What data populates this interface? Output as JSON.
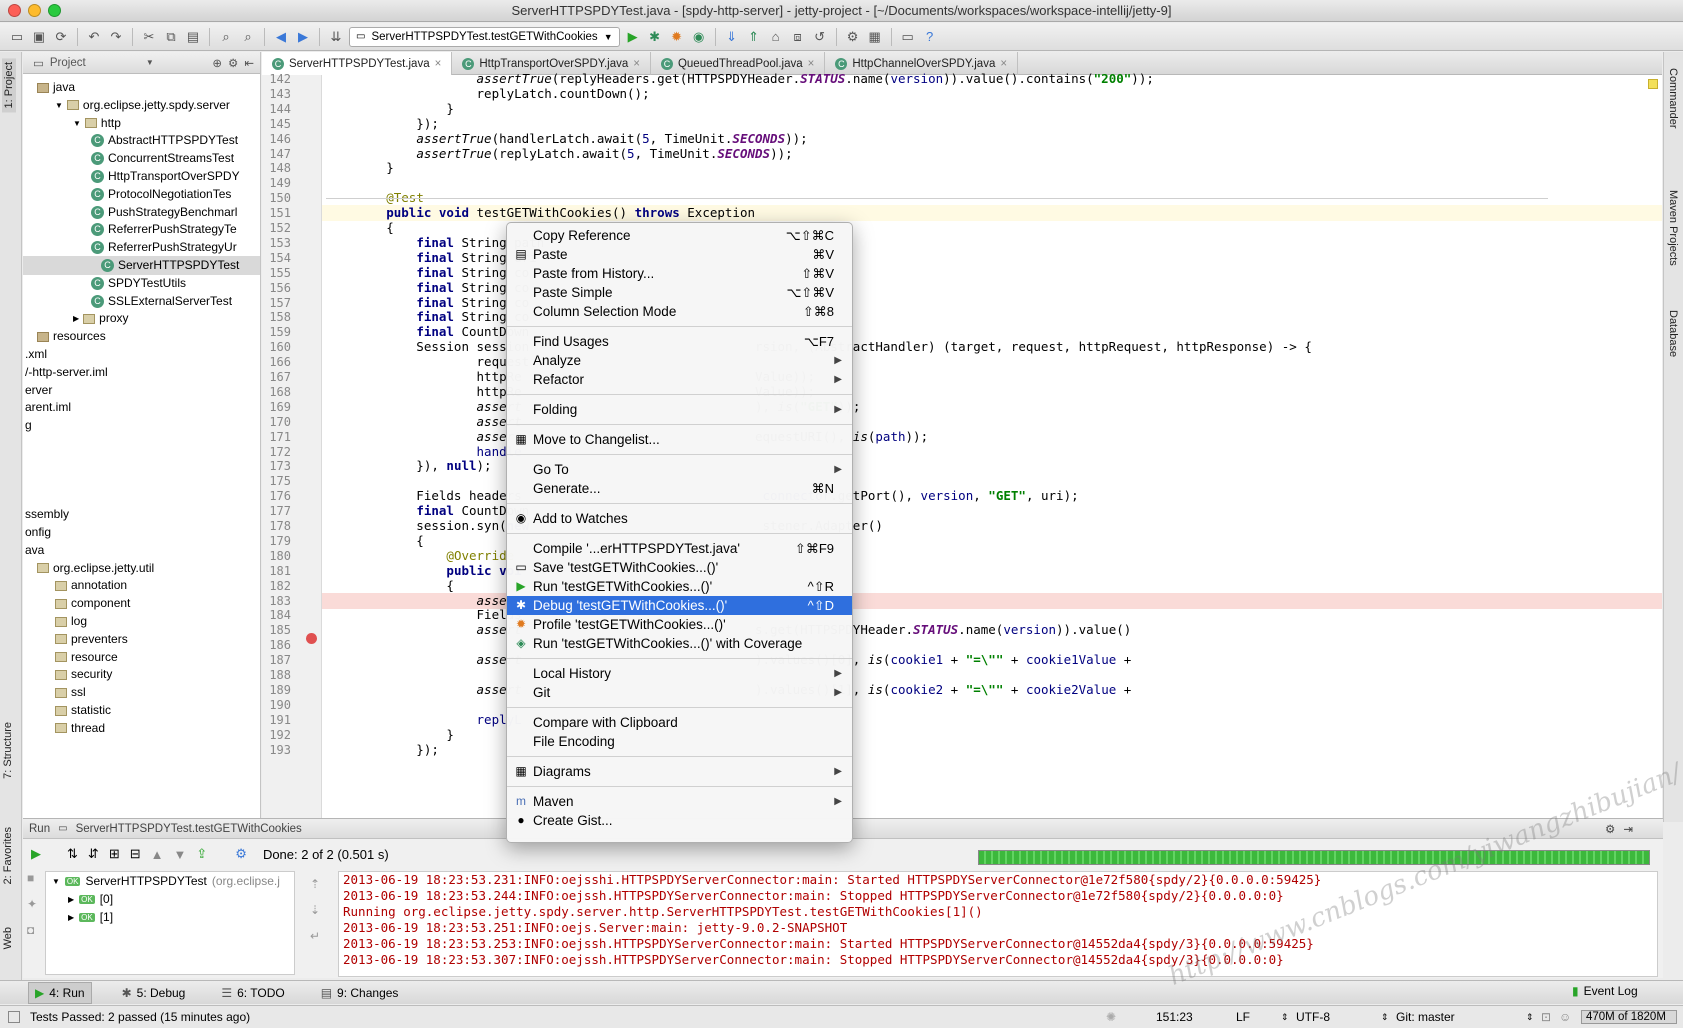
{
  "window": {
    "title": "ServerHTTPSPDYTest.java - [spdy-http-server] - jetty-project - [~/Documents/workspaces/workspace-intellij/jetty-9]"
  },
  "toolbar": {
    "run_config": "ServerHTTPSPDYTest.testGETWithCookies"
  },
  "left_strip": {
    "project": "1: Project",
    "structure": "7: Structure",
    "favorites": "2: Favorites",
    "web": "Web"
  },
  "right_strip": {
    "commander": "Commander",
    "maven": "Maven Projects",
    "database": "Database"
  },
  "project_panel": {
    "header": "Project",
    "nodes": [
      {
        "label": "java",
        "depth": 0,
        "icon": "folder-icon"
      },
      {
        "label": "org.eclipse.jetty.spdy.server",
        "depth": 1,
        "icon": "package-icon"
      },
      {
        "label": "http",
        "depth": 2,
        "icon": "package-icon"
      },
      {
        "label": "AbstractHTTPSPDYTest",
        "depth": 3,
        "icon": "class-icon"
      },
      {
        "label": "ConcurrentStreamsTest",
        "depth": 3,
        "icon": "class-icon"
      },
      {
        "label": "HttpTransportOverSPDY",
        "depth": 3,
        "icon": "class-icon"
      },
      {
        "label": "ProtocolNegotiationTes",
        "depth": 3,
        "icon": "class-icon"
      },
      {
        "label": "PushStrategyBenchmarl",
        "depth": 3,
        "icon": "class-icon"
      },
      {
        "label": "ReferrerPushStrategyTe",
        "depth": 3,
        "icon": "class-icon"
      },
      {
        "label": "ReferrerPushStrategyUr",
        "depth": 3,
        "icon": "class-icon"
      },
      {
        "label": "ServerHTTPSPDYTest",
        "depth": 3,
        "icon": "class-icon",
        "selected": true
      },
      {
        "label": "SPDYTestUtils",
        "depth": 3,
        "icon": "class-icon"
      },
      {
        "label": "SSLExternalServerTest",
        "depth": 3,
        "icon": "class-icon"
      },
      {
        "label": "proxy",
        "depth": 2,
        "icon": "package-icon"
      },
      {
        "label": "resources",
        "depth": 0,
        "icon": "folder-icon"
      },
      {
        "label": ".xml",
        "depth": -1,
        "icon": ""
      },
      {
        "label": "/-http-server.iml",
        "depth": -1,
        "icon": ""
      },
      {
        "label": "erver",
        "depth": -1,
        "icon": ""
      },
      {
        "label": "arent.iml",
        "depth": -1,
        "icon": ""
      },
      {
        "label": "g",
        "depth": -1,
        "icon": ""
      },
      {
        "label": "",
        "depth": -1,
        "icon": ""
      },
      {
        "label": "",
        "depth": -1,
        "icon": ""
      },
      {
        "label": "",
        "depth": -1,
        "icon": ""
      },
      {
        "label": "",
        "depth": -1,
        "icon": ""
      },
      {
        "label": "ssembly",
        "depth": -1,
        "icon": ""
      },
      {
        "label": "onfig",
        "depth": -1,
        "icon": ""
      },
      {
        "label": "ava",
        "depth": -1,
        "icon": ""
      },
      {
        "label": "org.eclipse.jetty.util",
        "depth": 0,
        "icon": "package-icon"
      },
      {
        "label": "annotation",
        "depth": 1,
        "icon": "package-icon"
      },
      {
        "label": "component",
        "depth": 1,
        "icon": "package-icon"
      },
      {
        "label": "log",
        "depth": 1,
        "icon": "package-icon"
      },
      {
        "label": "preventers",
        "depth": 1,
        "icon": "package-icon"
      },
      {
        "label": "resource",
        "depth": 1,
        "icon": "package-icon"
      },
      {
        "label": "security",
        "depth": 1,
        "icon": "package-icon"
      },
      {
        "label": "ssl",
        "depth": 1,
        "icon": "package-icon"
      },
      {
        "label": "statistic",
        "depth": 1,
        "icon": "package-icon"
      },
      {
        "label": "thread",
        "depth": 1,
        "icon": "package-icon"
      }
    ]
  },
  "editor_tabs": [
    {
      "label": "ServerHTTPSPDYTest.java",
      "active": true
    },
    {
      "label": "HttpTransportOverSPDY.java",
      "active": false
    },
    {
      "label": "QueuedThreadPool.java",
      "active": false
    },
    {
      "label": "HttpChannelOverSPDY.java",
      "active": false
    }
  ],
  "code_lines": [
    {
      "n": "142",
      "html": "                    <span class=\"itl\">assertTrue</span>(replyHeaders.get(HTTPSPDYHeader.<span class=\"fld\">STATUS</span>.name(<span class=\"var\">version</span>)).value().contains(<span class=\"str\">\"200\"</span>));"
    },
    {
      "n": "143",
      "html": "                    replyLatch.countDown();"
    },
    {
      "n": "144",
      "html": "                }"
    },
    {
      "n": "145",
      "html": "            });"
    },
    {
      "n": "146",
      "html": "            <span class=\"itl\">assertTrue</span>(handlerLatch.await(<span class=\"var\">5</span>, TimeUnit.<span class=\"fld\">SECONDS</span>));"
    },
    {
      "n": "147",
      "html": "            <span class=\"itl\">assertTrue</span>(replyLatch.await(<span class=\"var\">5</span>, TimeUnit.<span class=\"fld\">SECONDS</span>));"
    },
    {
      "n": "148",
      "html": "        }"
    },
    {
      "n": "149",
      "html": ""
    },
    {
      "n": "150",
      "html": "        <span class=\"ann\">@Test</span>"
    },
    {
      "n": "151",
      "html": "        <span class=\"kw\">public void</span> testGETWithCookies() <span class=\"kw\">throws</span> Exception"
    },
    {
      "n": "152",
      "html": "        {"
    },
    {
      "n": "153",
      "html": "            <span class=\"kw\">final</span> String path"
    },
    {
      "n": "154",
      "html": "            <span class=\"kw\">final</span> String uri"
    },
    {
      "n": "155",
      "html": "            <span class=\"kw\">final</span> String co"
    },
    {
      "n": "156",
      "html": "            <span class=\"kw\">final</span> String co"
    },
    {
      "n": "157",
      "html": "            <span class=\"kw\">final</span> String co"
    },
    {
      "n": "158",
      "html": "            <span class=\"kw\">final</span> String co"
    },
    {
      "n": "159",
      "html": "            <span class=\"kw\">final</span> CountDown"
    },
    {
      "n": "160",
      "html": "            Session session                              rsion, (AbstractHandler) (target, request, httpRequest, httpResponse) -> {"
    },
    {
      "n": "166",
      "html": "                    request"
    },
    {
      "n": "167",
      "html": "                    httpRe                               Value));"
    },
    {
      "n": "168",
      "html": "                    httpRe                               Value));"
    },
    {
      "n": "169",
      "html": "                    <span class=\"itl\">assert</span>                               ), <span class=\"itl\">is</span>(<span class=\"str\">\"GET\"</span>));"
    },
    {
      "n": "170",
      "html": "                    <span class=\"itl\">assert</span>"
    },
    {
      "n": "171",
      "html": "                    <span class=\"itl\">assert</span>                               equestURI(), <span class=\"itl\">is</span>(<span class=\"var\">path</span>));"
    },
    {
      "n": "172",
      "html": "                    <span class=\"var\">handle</span>"
    },
    {
      "n": "173",
      "html": "            }), <span class=\"kw\">null</span>);"
    },
    {
      "n": "175",
      "html": ""
    },
    {
      "n": "176",
      "html": "            Fields headers                                <span class=\"var\">connector</span>.getPort(), <span class=\"var\">version</span>, <span class=\"str\">\"GET\"</span>, uri);"
    },
    {
      "n": "177",
      "html": "            <span class=\"kw\">final</span> CountDown"
    },
    {
      "n": "178",
      "html": "            session.syn(<span class=\"kw\">new</span>                               stener.Adapter()"
    },
    {
      "n": "179",
      "html": "            {"
    },
    {
      "n": "180",
      "html": "                <span class=\"ann\">@Override</span>"
    },
    {
      "n": "181",
      "html": "                <span class=\"kw\">public voi</span>"
    },
    {
      "n": "182",
      "html": "                {"
    },
    {
      "n": "183",
      "html": "                    <span class=\"itl\">assert</span>                                 <span class=\"itl\">is</span>(<span class=\"kw\">true</span>));"
    },
    {
      "n": "184",
      "html": "                    Fields"
    },
    {
      "n": "185",
      "html": "                    <span class=\"itl\">assert</span>                               s.get(HTTPSPDYHeader.<span class=\"fld\">STATUS</span>.name(<span class=\"var\">version</span>)).value()"
    },
    {
      "n": "186",
      "html": ""
    },
    {
      "n": "187",
      "html": "                    <span class=\"itl\">assert</span>                               ).values()[0], <span class=\"itl\">is</span>(<span class=\"var\">cookie1</span> + <span class=\"str\">\"=\\\"\"</span> + <span class=\"var\">cookie1Value</span> +"
    },
    {
      "n": "188",
      "html": ""
    },
    {
      "n": "189",
      "html": "                    <span class=\"itl\">assert</span>                               ).values()[1], <span class=\"itl\">is</span>(<span class=\"var\">cookie2</span> + <span class=\"str\">\"=\\\"\"</span> + <span class=\"var\">cookie2Value</span> +"
    },
    {
      "n": "190",
      "html": ""
    },
    {
      "n": "191",
      "html": "                    <span class=\"var\">replyL</span>"
    },
    {
      "n": "192",
      "html": "                }"
    },
    {
      "n": "193",
      "html": "            });"
    }
  ],
  "context_menu": {
    "groups": [
      [
        {
          "label": "Copy Reference",
          "shortcut": "⌥⇧⌘C",
          "icon": ""
        },
        {
          "label": "Paste",
          "shortcut": "⌘V",
          "icon": "paste-icon"
        },
        {
          "label": "Paste from History...",
          "shortcut": "⇧⌘V",
          "icon": ""
        },
        {
          "label": "Paste Simple",
          "shortcut": "⌥⇧⌘V",
          "icon": ""
        },
        {
          "label": "Column Selection Mode",
          "shortcut": "⇧⌘8",
          "icon": ""
        }
      ],
      [
        {
          "label": "Find Usages",
          "shortcut": "⌥F7",
          "icon": ""
        },
        {
          "label": "Analyze",
          "shortcut": "",
          "icon": "",
          "submenu": true
        },
        {
          "label": "Refactor",
          "shortcut": "",
          "icon": "",
          "submenu": true
        }
      ],
      [
        {
          "label": "Folding",
          "shortcut": "",
          "icon": "",
          "submenu": true
        }
      ],
      [
        {
          "label": "Move to Changelist...",
          "shortcut": "",
          "icon": "changelist-icon"
        }
      ],
      [
        {
          "label": "Go To",
          "shortcut": "",
          "icon": "",
          "submenu": true
        },
        {
          "label": "Generate...",
          "shortcut": "⌘N",
          "icon": ""
        }
      ],
      [
        {
          "label": "Add to Watches",
          "shortcut": "",
          "icon": "watch-icon"
        }
      ],
      [
        {
          "label": "Compile '...erHTTPSPDYTest.java'",
          "shortcut": "⇧⌘F9",
          "icon": ""
        },
        {
          "label": "Save 'testGETWithCookies...()'",
          "shortcut": "",
          "icon": "save-config-icon"
        },
        {
          "label": "Run 'testGETWithCookies...()'",
          "shortcut": "^⇧R",
          "icon": "run-icon"
        },
        {
          "label": "Debug 'testGETWithCookies...()'",
          "shortcut": "^⇧D",
          "icon": "debug-icon",
          "selected": true
        },
        {
          "label": "Profile 'testGETWithCookies...()'",
          "shortcut": "",
          "icon": "profile-icon"
        },
        {
          "label": "Run 'testGETWithCookies...()' with Coverage",
          "shortcut": "",
          "icon": "coverage-icon"
        }
      ],
      [
        {
          "label": "Local History",
          "shortcut": "",
          "icon": "",
          "submenu": true
        },
        {
          "label": "Git",
          "shortcut": "",
          "icon": "",
          "submenu": true
        }
      ],
      [
        {
          "label": "Compare with Clipboard",
          "shortcut": "",
          "icon": ""
        },
        {
          "label": "File Encoding",
          "shortcut": "",
          "icon": ""
        }
      ],
      [
        {
          "label": "Diagrams",
          "shortcut": "",
          "icon": "diagram-icon",
          "submenu": true
        }
      ],
      [
        {
          "label": "Maven",
          "shortcut": "",
          "icon": "maven-icon",
          "submenu": true
        },
        {
          "label": "Create Gist...",
          "shortcut": "",
          "icon": "github-icon"
        }
      ]
    ]
  },
  "run_panel": {
    "header_label": "Run",
    "header_config": "ServerHTTPSPDYTest.testGETWithCookies",
    "status": "Done: 2 of 2 (0.501 s)",
    "tree_root": "ServerHTTPSPDYTest",
    "tree_root_suffix": "(org.eclipse.j",
    "tree_children": [
      "[0]",
      "[1]"
    ],
    "console_lines": [
      "2013-06-19 18:23:53.231:INFO:oejsshi.HTTPSPDYServerConnector:main: Started HTTPSPDYServerConnector@1e72f580{spdy/2}{0.0.0.0:59425}",
      "2013-06-19 18:23:53.244:INFO:oejssh.HTTPSPDYServerConnector:main: Stopped HTTPSPDYServerConnector@1e72f580{spdy/2}{0.0.0.0:0}",
      "Running org.eclipse.jetty.spdy.server.http.ServerHTTPSPDYTest.testGETWithCookies[1]()",
      "2013-06-19 18:23:53.251:INFO:oejs.Server:main: jetty-9.0.2-SNAPSHOT",
      "2013-06-19 18:23:53.253:INFO:oejssh.HTTPSPDYServerConnector:main: Started HTTPSPDYServerConnector@14552da4{spdy/3}{0.0.0.0:59425}",
      "2013-06-19 18:23:53.307:INFO:oejssh.HTTPSPDYServerConnector:main: Stopped HTTPSPDYServerConnector@14552da4{spdy/3}{0.0.0.0:0}"
    ],
    "progress": 1.0
  },
  "bottom_tabs": [
    {
      "label": "4: Run",
      "icon": "run-icon"
    },
    {
      "label": "5: Debug",
      "icon": "debug-icon"
    },
    {
      "label": "6: TODO",
      "icon": "todo-icon"
    },
    {
      "label": "9: Changes",
      "icon": "changes-icon"
    }
  ],
  "event_log": "Event Log",
  "status_bar": {
    "message": "Tests Passed: 2 passed (15 minutes ago)",
    "position": "151:23",
    "line_sep": "LF",
    "encoding": "UTF-8",
    "vcs": "Git: master",
    "memory": "470M of 1820M"
  },
  "watermark": "http://www.cnblogs.com/yiwangzhibujian/",
  "colors": {
    "selection": "#2f6fde",
    "breakpoint_line": "#fadbd8",
    "caret_line": "#fffae3"
  }
}
